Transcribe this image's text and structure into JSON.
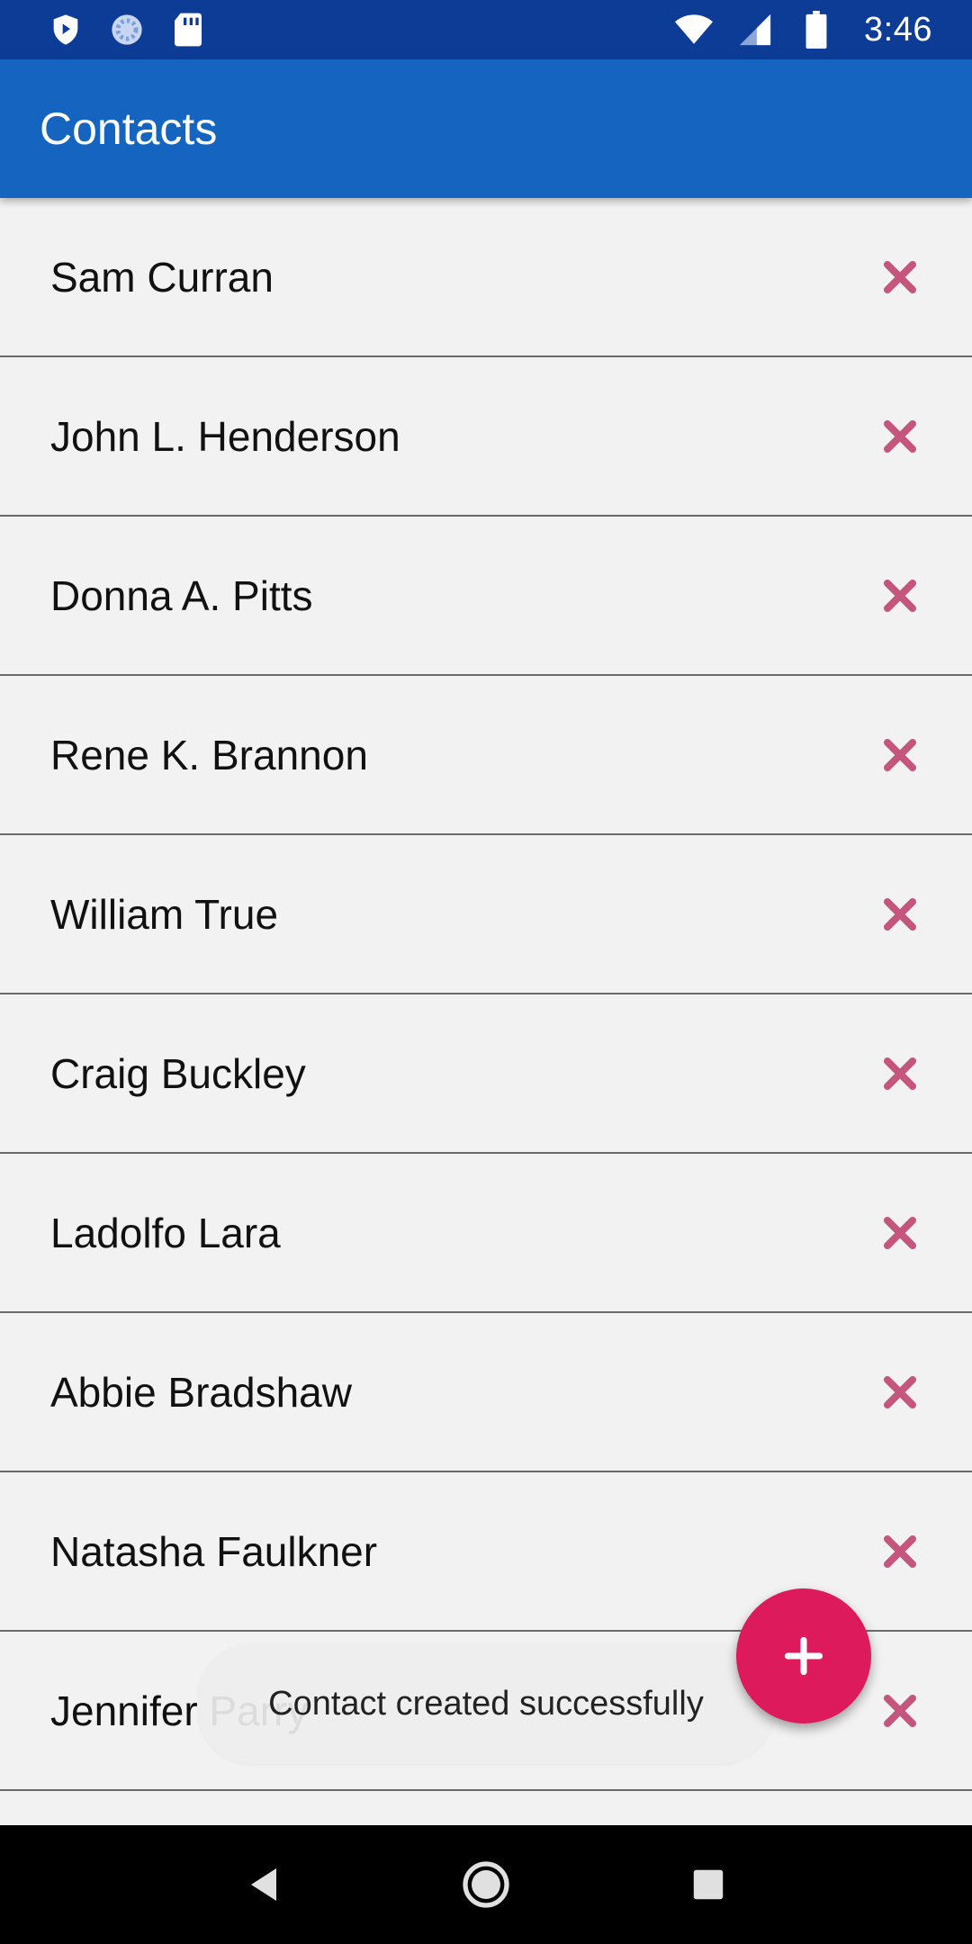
{
  "status_bar": {
    "time": "3:46",
    "left_icons": [
      "shield-icon",
      "sync-icon",
      "sd-card-icon"
    ],
    "right_icons": [
      "wifi-icon",
      "signal-icon",
      "battery-icon"
    ]
  },
  "app_bar": {
    "title": "Contacts"
  },
  "contacts": [
    {
      "name": "Sam Curran"
    },
    {
      "name": "John L. Henderson"
    },
    {
      "name": "Donna A. Pitts"
    },
    {
      "name": "Rene K. Brannon"
    },
    {
      "name": "William True"
    },
    {
      "name": "Craig Buckley"
    },
    {
      "name": "Ladolfo Lara"
    },
    {
      "name": "Abbie Bradshaw"
    },
    {
      "name": "Natasha Faulkner"
    },
    {
      "name": "Jennifer Parry"
    }
  ],
  "delete_icon": "close-icon",
  "snackbar": {
    "message": "Contact created successfully"
  },
  "fab": {
    "icon": "plus-icon"
  },
  "nav_bar": {
    "buttons": [
      "back-icon",
      "home-icon",
      "recents-icon"
    ]
  },
  "colors": {
    "status_bar": "#0d3c96",
    "app_bar": "#1565c0",
    "fab": "#dc1a5c",
    "delete_icon": "#c4567e",
    "background": "#f2f2f2"
  }
}
